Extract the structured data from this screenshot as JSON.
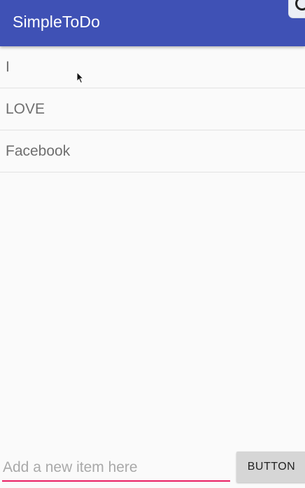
{
  "app_bar": {
    "title": "SimpleToDo",
    "color": "#3f51b5"
  },
  "todo_list": {
    "items": [
      {
        "label": "I"
      },
      {
        "label": "LOVE"
      },
      {
        "label": "Facebook"
      }
    ]
  },
  "add_bar": {
    "input_value": "",
    "input_placeholder": "Add a new item here",
    "button_label": "BUTTON",
    "underline_color": "#e91e63"
  },
  "icons": {
    "cursor": "mouse-pointer-icon",
    "corner": "overlay-indicator-icon"
  }
}
